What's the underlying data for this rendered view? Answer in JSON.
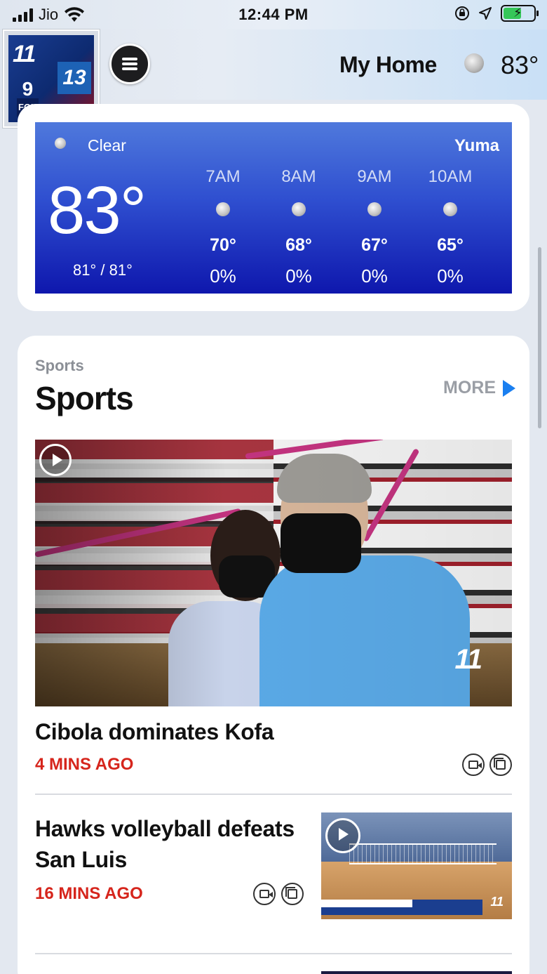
{
  "status_bar": {
    "carrier": "Jio",
    "time": "12:44 PM"
  },
  "header": {
    "logo": {
      "brand_11": "11",
      "brand_13": "13",
      "brand_9": "9",
      "brand_fox": "FOX"
    },
    "title": "My Home",
    "temp": "83°",
    "icons": [
      "menu-icon",
      "moon-icon"
    ]
  },
  "weather": {
    "condition": "Clear",
    "city": "Yuma",
    "current_temp": "83°",
    "hi_lo": "81° / 81°",
    "hourly": [
      {
        "time": "7AM",
        "temp": "70°",
        "precip": "0%"
      },
      {
        "time": "8AM",
        "temp": "68°",
        "precip": "0%"
      },
      {
        "time": "9AM",
        "temp": "67°",
        "precip": "0%"
      },
      {
        "time": "10AM",
        "temp": "65°",
        "precip": "0%"
      }
    ]
  },
  "sports": {
    "kicker": "Sports",
    "title": "Sports",
    "more_label": "MORE",
    "stories": [
      {
        "headline": "Cibola dominates Kofa",
        "time_ago": "4 MINS AGO"
      },
      {
        "headline_line1": "Hawks volleyball defeats",
        "headline_line2": "San Luis",
        "time_ago": "16 MINS AGO"
      }
    ]
  },
  "colors": {
    "accent_blue": "#1a7ff0",
    "timestamp_red": "#d6251c",
    "weather_top": "#4f79dc",
    "weather_bottom": "#0e17ad"
  }
}
